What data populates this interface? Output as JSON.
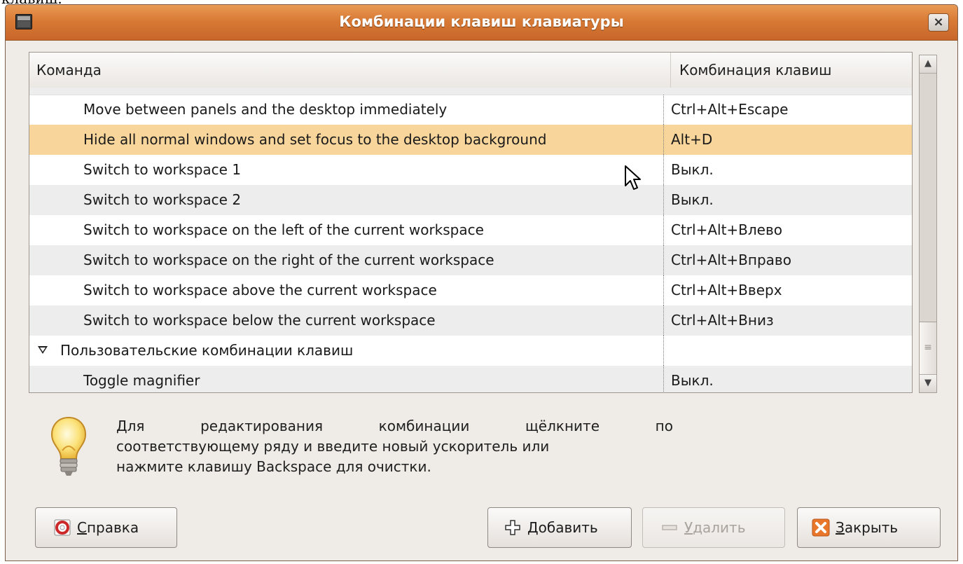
{
  "top_fragment": "клавиш.",
  "window": {
    "title": "Комбинации клавиш клавиатуры",
    "close_glyph": "×"
  },
  "table": {
    "columns": [
      "Команда",
      "Комбинация клавиш"
    ],
    "rows": [
      {
        "command": "Move between panels and the desktop immediately",
        "shortcut": "Ctrl+Alt+Escape"
      },
      {
        "command": "Hide all normal windows and set focus to the desktop background",
        "shortcut": "Alt+D",
        "selected": true
      },
      {
        "command": "Switch to workspace 1",
        "shortcut": "Выкл."
      },
      {
        "command": "Switch to workspace 2",
        "shortcut": "Выкл."
      },
      {
        "command": "Switch to workspace on the left of the current workspace",
        "shortcut": "Ctrl+Alt+Влево"
      },
      {
        "command": "Switch to workspace on the right of the current workspace",
        "shortcut": "Ctrl+Alt+Вправо"
      },
      {
        "command": "Switch to workspace above the current workspace",
        "shortcut": "Ctrl+Alt+Вверх"
      },
      {
        "command": "Switch to workspace below the current workspace",
        "shortcut": "Ctrl+Alt+Вниз"
      },
      {
        "command": "Пользовательские комбинации клавиш",
        "shortcut": "",
        "group": true,
        "expanded": true
      },
      {
        "command": "Toggle magnifier",
        "shortcut": "Выкл."
      }
    ]
  },
  "hint": {
    "line1_words": [
      "Для",
      "редактирования",
      "комбинации",
      "щёлкните",
      "по"
    ],
    "line2": "соответствующему ряду и введите новый ускоритель или",
    "line3": "нажмите клавишу Backspace для очистки."
  },
  "buttons": {
    "help": {
      "mnemonic": "С",
      "rest": "правка",
      "icon": "help-icon"
    },
    "add": {
      "mnemonic": "Д",
      "rest": "обавить",
      "icon": "add-icon"
    },
    "remove": {
      "mnemonic": "У",
      "rest": "далить",
      "icon": "remove-icon",
      "disabled": true
    },
    "close": {
      "mnemonic": "З",
      "rest": "акрыть",
      "icon": "close-x-icon"
    }
  },
  "colors": {
    "titlebar": "#d87a35",
    "selected_row": "#f8d59b",
    "dialog_bg": "#efebe7"
  }
}
